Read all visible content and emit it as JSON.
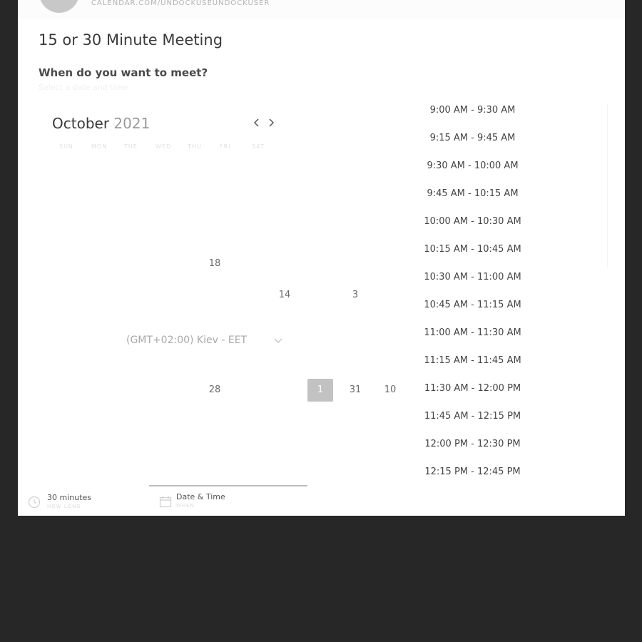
{
  "header": {
    "url": "CALENDAR.COM/UNDOCKUSEUNDOCKUSER"
  },
  "meeting": {
    "title": "15 or 30 Minute Meeting",
    "question": "When do you want to meet?",
    "hint": "Select a date and time"
  },
  "calendar": {
    "month": "October",
    "year": "2021",
    "prev_icon": "chevron-left-icon",
    "next_icon": "chevron-right-icon",
    "weekdays": [
      "SUN",
      "MON",
      "TUE",
      "WED",
      "THU",
      "FRI",
      "SAT"
    ],
    "visible_days": [
      "18",
      "14",
      "3",
      "28",
      "1",
      "31",
      "10"
    ],
    "selected_day": "1"
  },
  "timezone": {
    "label": "(GMT+02:00) Kiev - EET",
    "icon": "chevron-down-icon"
  },
  "time_slots": [
    "9:00 AM - 9:30 AM",
    "9:15 AM - 9:45 AM",
    "9:30 AM - 10:00 AM",
    "9:45 AM - 10:15 AM",
    "10:00 AM - 10:30 AM",
    "10:15 AM - 10:45 AM",
    "10:30 AM - 11:00 AM",
    "10:45 AM - 11:15 AM",
    "11:00 AM - 11:30 AM",
    "11:15 AM - 11:45 AM",
    "11:30 AM - 12:00 PM",
    "11:45 AM - 12:15 PM",
    "12:00 PM - 12:30 PM",
    "12:15 PM - 12:45 PM"
  ],
  "tabs": {
    "duration": {
      "label": "30 minutes",
      "sub": "HOW LONG",
      "icon": "clock-icon"
    },
    "datetime": {
      "label": "Date & Time",
      "sub": "WHEN",
      "icon": "calendar-icon"
    }
  },
  "colors": {
    "background": "#272727",
    "card": "#ffffff",
    "selected_day": "#c2c2c2"
  }
}
